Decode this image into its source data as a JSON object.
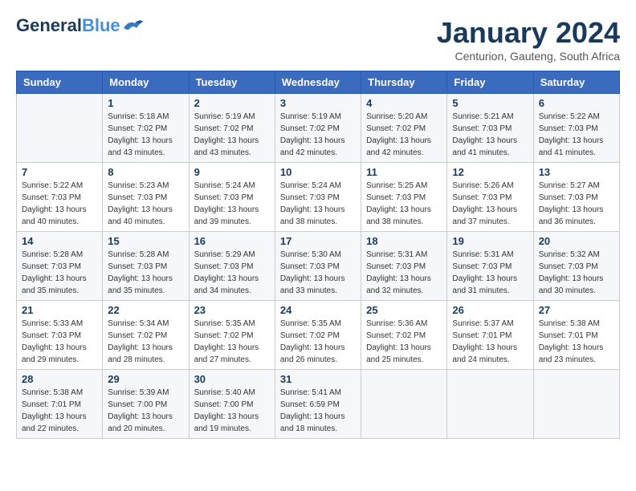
{
  "header": {
    "logo_line1": "General",
    "logo_line2": "Blue",
    "title": "January 2024",
    "subtitle": "Centurion, Gauteng, South Africa"
  },
  "columns": [
    "Sunday",
    "Monday",
    "Tuesday",
    "Wednesday",
    "Thursday",
    "Friday",
    "Saturday"
  ],
  "weeks": [
    [
      {
        "day": "",
        "sunrise": "",
        "sunset": "",
        "daylight": ""
      },
      {
        "day": "1",
        "sunrise": "Sunrise: 5:18 AM",
        "sunset": "Sunset: 7:02 PM",
        "daylight": "Daylight: 13 hours and 43 minutes."
      },
      {
        "day": "2",
        "sunrise": "Sunrise: 5:19 AM",
        "sunset": "Sunset: 7:02 PM",
        "daylight": "Daylight: 13 hours and 43 minutes."
      },
      {
        "day": "3",
        "sunrise": "Sunrise: 5:19 AM",
        "sunset": "Sunset: 7:02 PM",
        "daylight": "Daylight: 13 hours and 42 minutes."
      },
      {
        "day": "4",
        "sunrise": "Sunrise: 5:20 AM",
        "sunset": "Sunset: 7:02 PM",
        "daylight": "Daylight: 13 hours and 42 minutes."
      },
      {
        "day": "5",
        "sunrise": "Sunrise: 5:21 AM",
        "sunset": "Sunset: 7:03 PM",
        "daylight": "Daylight: 13 hours and 41 minutes."
      },
      {
        "day": "6",
        "sunrise": "Sunrise: 5:22 AM",
        "sunset": "Sunset: 7:03 PM",
        "daylight": "Daylight: 13 hours and 41 minutes."
      }
    ],
    [
      {
        "day": "7",
        "sunrise": "Sunrise: 5:22 AM",
        "sunset": "Sunset: 7:03 PM",
        "daylight": "Daylight: 13 hours and 40 minutes."
      },
      {
        "day": "8",
        "sunrise": "Sunrise: 5:23 AM",
        "sunset": "Sunset: 7:03 PM",
        "daylight": "Daylight: 13 hours and 40 minutes."
      },
      {
        "day": "9",
        "sunrise": "Sunrise: 5:24 AM",
        "sunset": "Sunset: 7:03 PM",
        "daylight": "Daylight: 13 hours and 39 minutes."
      },
      {
        "day": "10",
        "sunrise": "Sunrise: 5:24 AM",
        "sunset": "Sunset: 7:03 PM",
        "daylight": "Daylight: 13 hours and 38 minutes."
      },
      {
        "day": "11",
        "sunrise": "Sunrise: 5:25 AM",
        "sunset": "Sunset: 7:03 PM",
        "daylight": "Daylight: 13 hours and 38 minutes."
      },
      {
        "day": "12",
        "sunrise": "Sunrise: 5:26 AM",
        "sunset": "Sunset: 7:03 PM",
        "daylight": "Daylight: 13 hours and 37 minutes."
      },
      {
        "day": "13",
        "sunrise": "Sunrise: 5:27 AM",
        "sunset": "Sunset: 7:03 PM",
        "daylight": "Daylight: 13 hours and 36 minutes."
      }
    ],
    [
      {
        "day": "14",
        "sunrise": "Sunrise: 5:28 AM",
        "sunset": "Sunset: 7:03 PM",
        "daylight": "Daylight: 13 hours and 35 minutes."
      },
      {
        "day": "15",
        "sunrise": "Sunrise: 5:28 AM",
        "sunset": "Sunset: 7:03 PM",
        "daylight": "Daylight: 13 hours and 35 minutes."
      },
      {
        "day": "16",
        "sunrise": "Sunrise: 5:29 AM",
        "sunset": "Sunset: 7:03 PM",
        "daylight": "Daylight: 13 hours and 34 minutes."
      },
      {
        "day": "17",
        "sunrise": "Sunrise: 5:30 AM",
        "sunset": "Sunset: 7:03 PM",
        "daylight": "Daylight: 13 hours and 33 minutes."
      },
      {
        "day": "18",
        "sunrise": "Sunrise: 5:31 AM",
        "sunset": "Sunset: 7:03 PM",
        "daylight": "Daylight: 13 hours and 32 minutes."
      },
      {
        "day": "19",
        "sunrise": "Sunrise: 5:31 AM",
        "sunset": "Sunset: 7:03 PM",
        "daylight": "Daylight: 13 hours and 31 minutes."
      },
      {
        "day": "20",
        "sunrise": "Sunrise: 5:32 AM",
        "sunset": "Sunset: 7:03 PM",
        "daylight": "Daylight: 13 hours and 30 minutes."
      }
    ],
    [
      {
        "day": "21",
        "sunrise": "Sunrise: 5:33 AM",
        "sunset": "Sunset: 7:03 PM",
        "daylight": "Daylight: 13 hours and 29 minutes."
      },
      {
        "day": "22",
        "sunrise": "Sunrise: 5:34 AM",
        "sunset": "Sunset: 7:02 PM",
        "daylight": "Daylight: 13 hours and 28 minutes."
      },
      {
        "day": "23",
        "sunrise": "Sunrise: 5:35 AM",
        "sunset": "Sunset: 7:02 PM",
        "daylight": "Daylight: 13 hours and 27 minutes."
      },
      {
        "day": "24",
        "sunrise": "Sunrise: 5:35 AM",
        "sunset": "Sunset: 7:02 PM",
        "daylight": "Daylight: 13 hours and 26 minutes."
      },
      {
        "day": "25",
        "sunrise": "Sunrise: 5:36 AM",
        "sunset": "Sunset: 7:02 PM",
        "daylight": "Daylight: 13 hours and 25 minutes."
      },
      {
        "day": "26",
        "sunrise": "Sunrise: 5:37 AM",
        "sunset": "Sunset: 7:01 PM",
        "daylight": "Daylight: 13 hours and 24 minutes."
      },
      {
        "day": "27",
        "sunrise": "Sunrise: 5:38 AM",
        "sunset": "Sunset: 7:01 PM",
        "daylight": "Daylight: 13 hours and 23 minutes."
      }
    ],
    [
      {
        "day": "28",
        "sunrise": "Sunrise: 5:38 AM",
        "sunset": "Sunset: 7:01 PM",
        "daylight": "Daylight: 13 hours and 22 minutes."
      },
      {
        "day": "29",
        "sunrise": "Sunrise: 5:39 AM",
        "sunset": "Sunset: 7:00 PM",
        "daylight": "Daylight: 13 hours and 20 minutes."
      },
      {
        "day": "30",
        "sunrise": "Sunrise: 5:40 AM",
        "sunset": "Sunset: 7:00 PM",
        "daylight": "Daylight: 13 hours and 19 minutes."
      },
      {
        "day": "31",
        "sunrise": "Sunrise: 5:41 AM",
        "sunset": "Sunset: 6:59 PM",
        "daylight": "Daylight: 13 hours and 18 minutes."
      },
      {
        "day": "",
        "sunrise": "",
        "sunset": "",
        "daylight": ""
      },
      {
        "day": "",
        "sunrise": "",
        "sunset": "",
        "daylight": ""
      },
      {
        "day": "",
        "sunrise": "",
        "sunset": "",
        "daylight": ""
      }
    ]
  ]
}
